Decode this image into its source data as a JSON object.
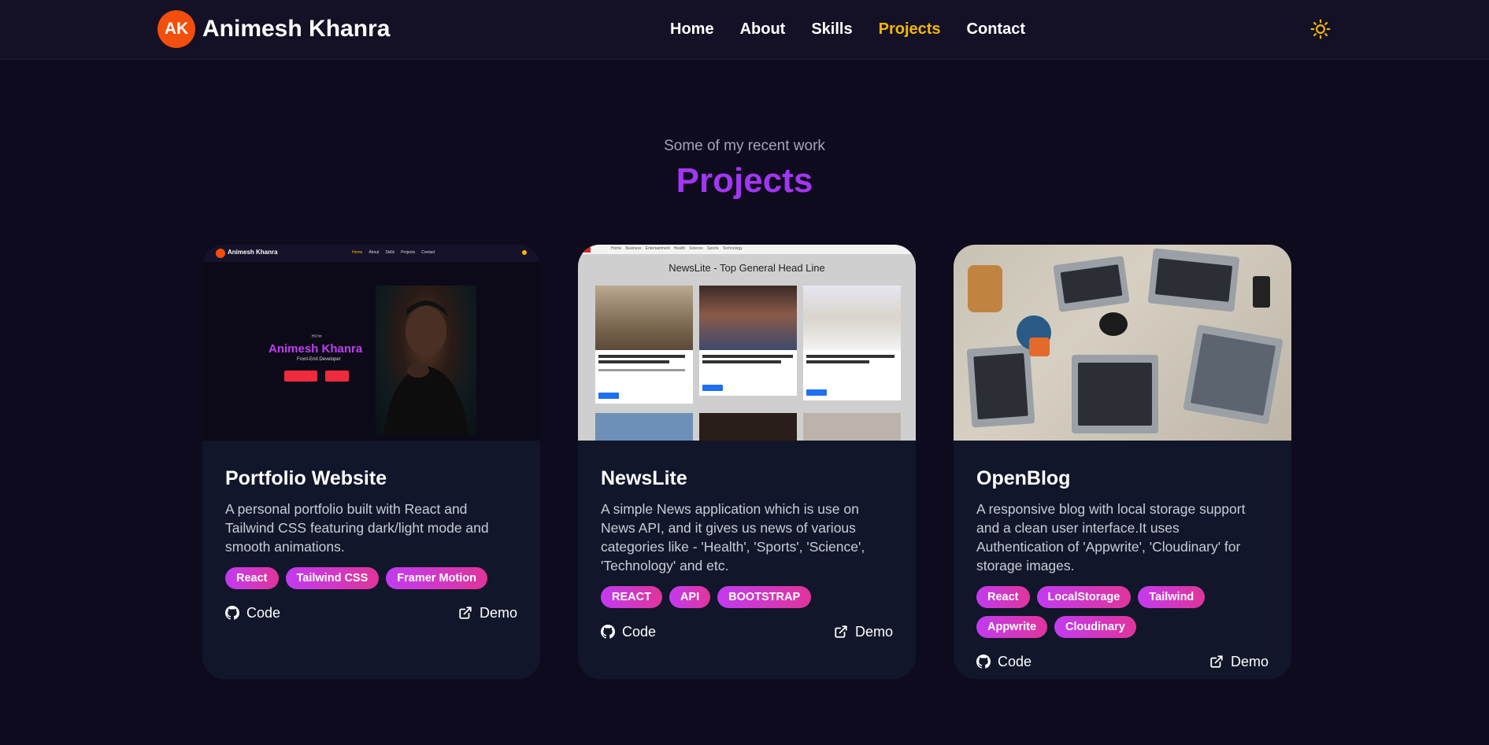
{
  "brand": {
    "logo_text": "AK",
    "name": "Animesh Khanra"
  },
  "nav": {
    "items": [
      {
        "label": "Home",
        "active": false
      },
      {
        "label": "About",
        "active": false
      },
      {
        "label": "Skills",
        "active": false
      },
      {
        "label": "Projects",
        "active": true
      },
      {
        "label": "Contact",
        "active": false
      }
    ],
    "theme_icon": "sun-icon"
  },
  "section": {
    "subtitle": "Some of my recent work",
    "title": "Projects"
  },
  "projects": [
    {
      "title": "Portfolio Website",
      "description": "A personal portfolio built with React and Tailwind CSS featuring dark/light mode and smooth animations.",
      "tags": [
        "React",
        "Tailwind CSS",
        "Framer Motion"
      ],
      "code_label": "Code",
      "demo_label": "Demo",
      "thumbnail": {
        "brand": "Animesh Khanra",
        "nav": [
          "Home",
          "About",
          "Skills",
          "Projects",
          "Contact"
        ],
        "hi": "Hi I'm",
        "title": "Animesh Khanra",
        "role": "Front-End Developer"
      }
    },
    {
      "title": "NewsLite",
      "description": "A simple News application which is use on News API, and it gives us news of various categories like - 'Health', 'Sports', 'Science', 'Technology' and etc.",
      "tags": [
        "REACT",
        "API",
        "BOOTSTRAP"
      ],
      "code_label": "Code",
      "demo_label": "Demo",
      "thumbnail": {
        "heading": "NewsLite - Top General Head Line",
        "nav": [
          "Home",
          "Business",
          "Entertainment",
          "Health",
          "Science",
          "Sports",
          "Technology"
        ]
      }
    },
    {
      "title": "OpenBlog",
      "description": "A responsive blog with local storage support and a clean user interface.It uses Authentication of 'Appwrite', 'Cloudinary' for storage images.",
      "tags": [
        "React",
        "LocalStorage",
        "Tailwind",
        "Appwrite",
        "Cloudinary"
      ],
      "code_label": "Code",
      "demo_label": "Demo"
    }
  ],
  "colors": {
    "background": "#0f0b1e",
    "navbar": "#141126",
    "accent_active_nav": "#f5b700",
    "title_purple": "#a236f2",
    "logo_orange": "#f24e0c",
    "card_bg": "#11162a",
    "tag_gradient_start": "#c23bf0",
    "tag_gradient_end": "#e0349a"
  }
}
